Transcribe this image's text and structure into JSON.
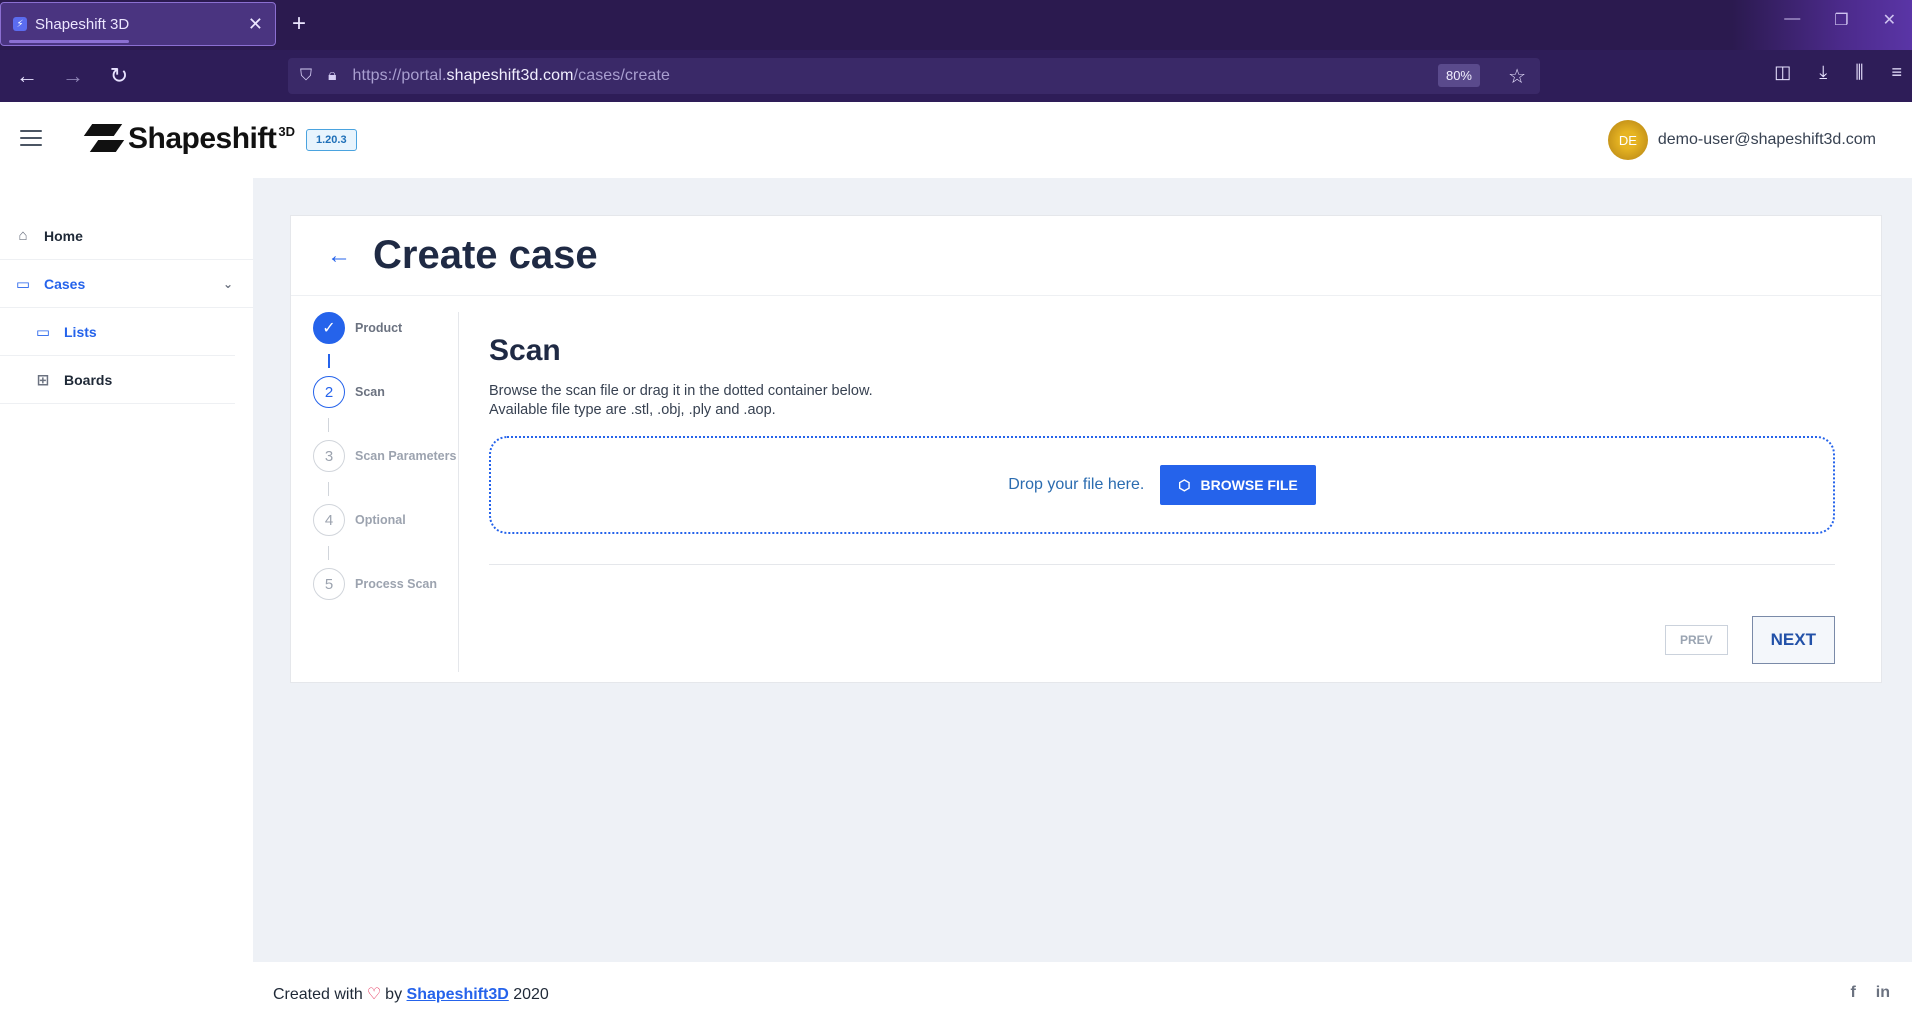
{
  "browser": {
    "tab_title": "Shapeshift 3D",
    "url_prefix": "https://portal.",
    "url_host": "shapeshift3d.com",
    "url_path": "/cases/create",
    "zoom": "80%"
  },
  "header": {
    "brand": "Shapeshift",
    "brand_sup": "3D",
    "version": "1.20.3",
    "avatar_initials": "DE",
    "user_email": "demo-user@shapeshift3d.com"
  },
  "sidebar": {
    "home": "Home",
    "cases": "Cases",
    "lists": "Lists",
    "boards": "Boards"
  },
  "page": {
    "title": "Create case"
  },
  "steps": [
    {
      "num": "1",
      "label": "Product",
      "state": "done"
    },
    {
      "num": "2",
      "label": "Scan",
      "state": "current"
    },
    {
      "num": "3",
      "label": "Scan Parameters",
      "state": "pending"
    },
    {
      "num": "4",
      "label": "Optional",
      "state": "pending"
    },
    {
      "num": "5",
      "label": "Process Scan",
      "state": "pending"
    }
  ],
  "scan": {
    "title": "Scan",
    "desc_line1": "Browse the scan file or drag it in the dotted container below.",
    "desc_line2": "Available file type are .stl, .obj, .ply and .aop.",
    "drop_text": "Drop your file here.",
    "browse_label": "BROWSE FILE"
  },
  "nav_buttons": {
    "prev": "PREV",
    "next": "NEXT"
  },
  "footer": {
    "created_with": "Created with",
    "by": "by",
    "link": "Shapeshift3D",
    "year": "2020",
    "social_fb": "f",
    "social_in": "in"
  },
  "colors": {
    "accent": "#2563eb",
    "browser_bg": "#2e1d58",
    "main_bg": "#eef1f6"
  }
}
